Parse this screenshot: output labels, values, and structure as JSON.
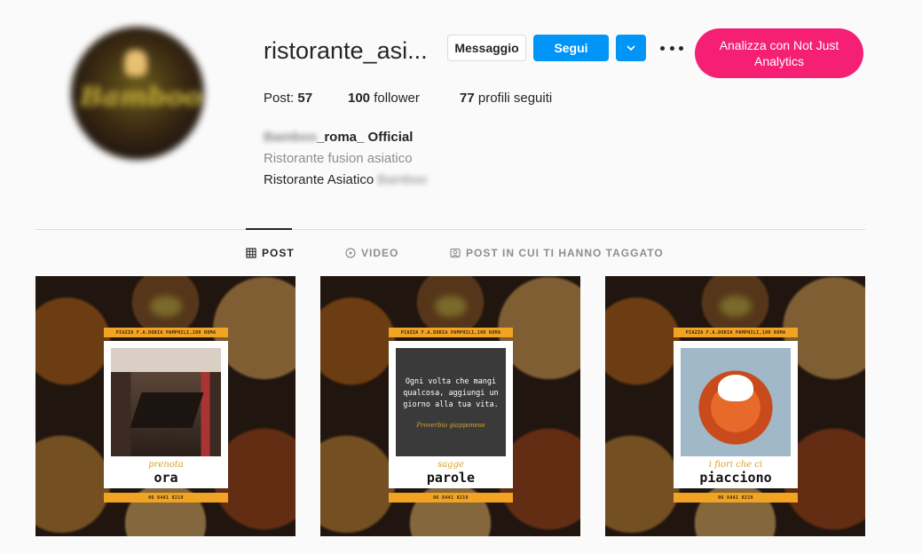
{
  "profile": {
    "username": "ristorante_asi...",
    "buttons": {
      "message": "Messaggio",
      "follow": "Segui"
    },
    "analytics_button": "Analizza con Not Just Analytics",
    "stats": {
      "posts_label": "Post:",
      "posts_count": "57",
      "followers_count": "100",
      "followers_label": "follower",
      "following_count": "77",
      "following_label": "profili seguiti"
    },
    "bio": {
      "name_blurred": "Bamboo",
      "name_visible": "_roma_ Official",
      "category": "Ristorante fusion asiatico",
      "text_visible": "Ristorante Asiatico",
      "text_blurred": "Bamboo"
    },
    "avatar_logo_blurred": "Bamboo"
  },
  "tabs": [
    {
      "label": "POST",
      "icon": "grid-icon",
      "active": true
    },
    {
      "label": "VIDEO",
      "icon": "play-icon",
      "active": false
    },
    {
      "label": "POST IN CUI TI HANNO TAGGATO",
      "icon": "tag-icon",
      "active": false
    }
  ],
  "posts": [
    {
      "band_top": "PIAZZA F.A.DORIA PAMPHILI,100 ROMA",
      "band_bottom": "06 8441 8219",
      "script": "prenota",
      "big": "ora"
    },
    {
      "band_top": "PIAZZA F.A.DORIA PAMPHILI,100 ROMA",
      "band_bottom": "06 8441 8219",
      "quote": "Ogni volta che mangi qualcosa, aggiungi un giorno alla tua vita.",
      "quote_source": "Proverbio giapponese",
      "script": "sagge",
      "big": "parole"
    },
    {
      "band_top": "PIAZZA F.A.DORIA PAMPHILI,100 ROMA",
      "band_bottom": "06 8441 8219",
      "script": "i fiori che ci",
      "big": "piacciono"
    }
  ],
  "colors": {
    "follow_blue": "#0095f6",
    "analytics_pink": "#f51f74",
    "band_orange": "#f2a322"
  }
}
